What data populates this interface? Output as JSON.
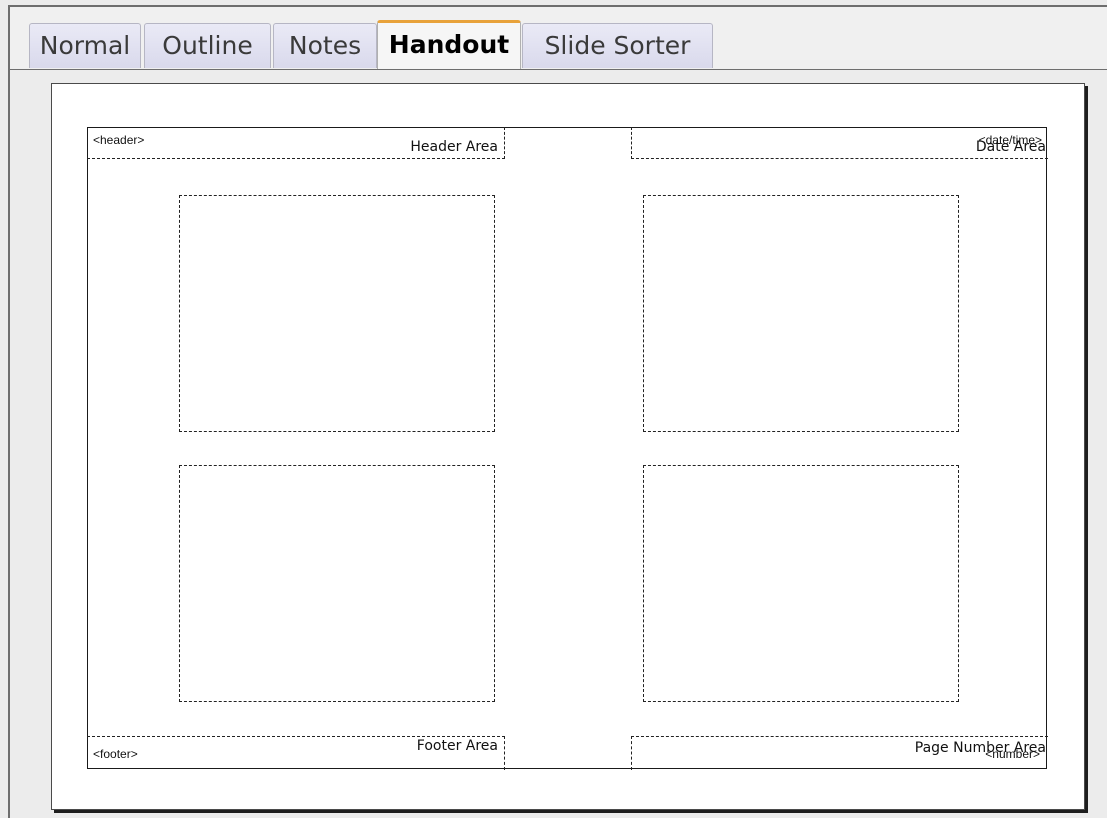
{
  "tabs": [
    {
      "label": "Normal",
      "active": false
    },
    {
      "label": "Outline",
      "active": false
    },
    {
      "label": "Notes",
      "active": false
    },
    {
      "label": "Handout",
      "active": true
    },
    {
      "label": "Slide Sorter",
      "active": false
    }
  ],
  "handout": {
    "header_area": {
      "title": "Header Area",
      "field": "<header>"
    },
    "date_area": {
      "title": "Date Area",
      "field": "<date/time>"
    },
    "footer_area": {
      "title": "Footer Area",
      "field": "<footer>"
    },
    "page_number_area": {
      "title": "Page Number Area",
      "field": "<number>"
    },
    "slide_count": 4
  },
  "colors": {
    "active_tab_accent": "#e8a23a",
    "inactive_tab": "#d9d9ec",
    "page_background": "#ffffff",
    "workspace_background": "#ececec"
  }
}
